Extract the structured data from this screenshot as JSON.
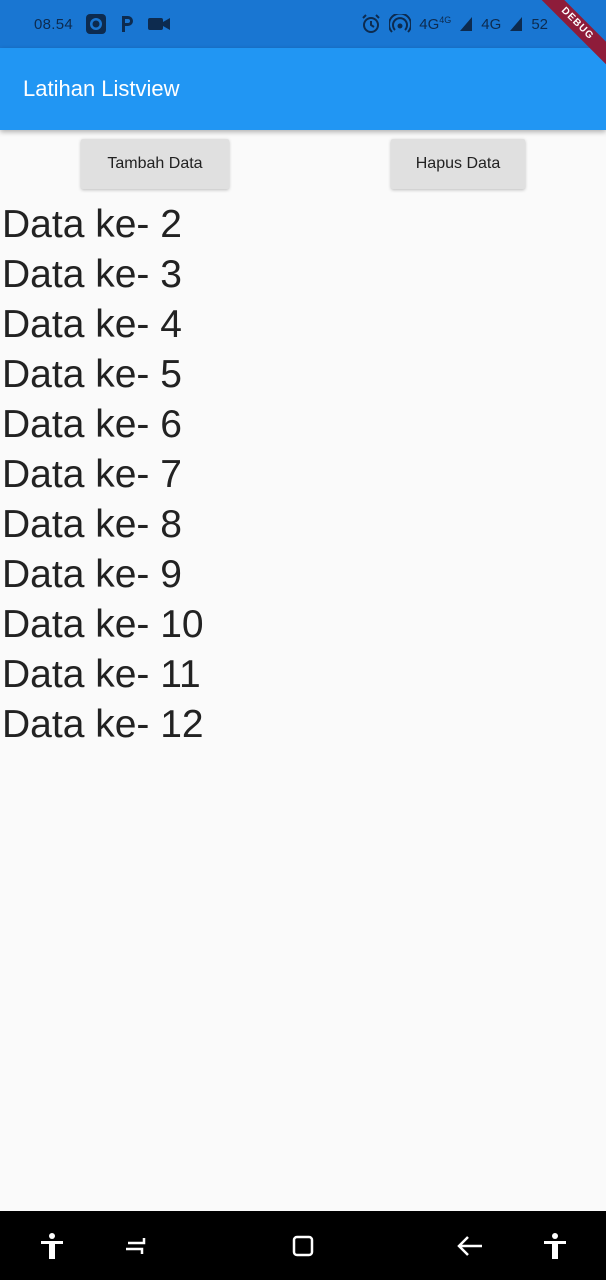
{
  "status_bar": {
    "time": "08.54",
    "network_1": "4G",
    "network_1_sup": "4G",
    "network_2": "4G",
    "battery": "52",
    "icons": [
      "screen-record-icon",
      "p-app-icon",
      "video-camera-icon",
      "alarm-icon",
      "hotspot-icon",
      "signal-icon",
      "signal-icon",
      "battery-icon"
    ],
    "bar_color": "#1976d2"
  },
  "debug_banner": "DEBUG",
  "app_bar": {
    "title": "Latihan Listview",
    "color": "#2196f3"
  },
  "buttons": {
    "add_label": "Tambah Data",
    "delete_label": "Hapus Data"
  },
  "list": {
    "items": [
      "Data ke- 2",
      "Data ke- 3",
      "Data ke- 4",
      "Data ke- 5",
      "Data ke- 6",
      "Data ke- 7",
      "Data ke- 8",
      "Data ke- 9",
      "Data ke- 10",
      "Data ke- 11",
      "Data ke- 12"
    ]
  },
  "nav_bar": {
    "icons": [
      "accessibility-icon",
      "recent-apps-icon",
      "home-icon",
      "back-icon",
      "accessibility-icon"
    ]
  }
}
